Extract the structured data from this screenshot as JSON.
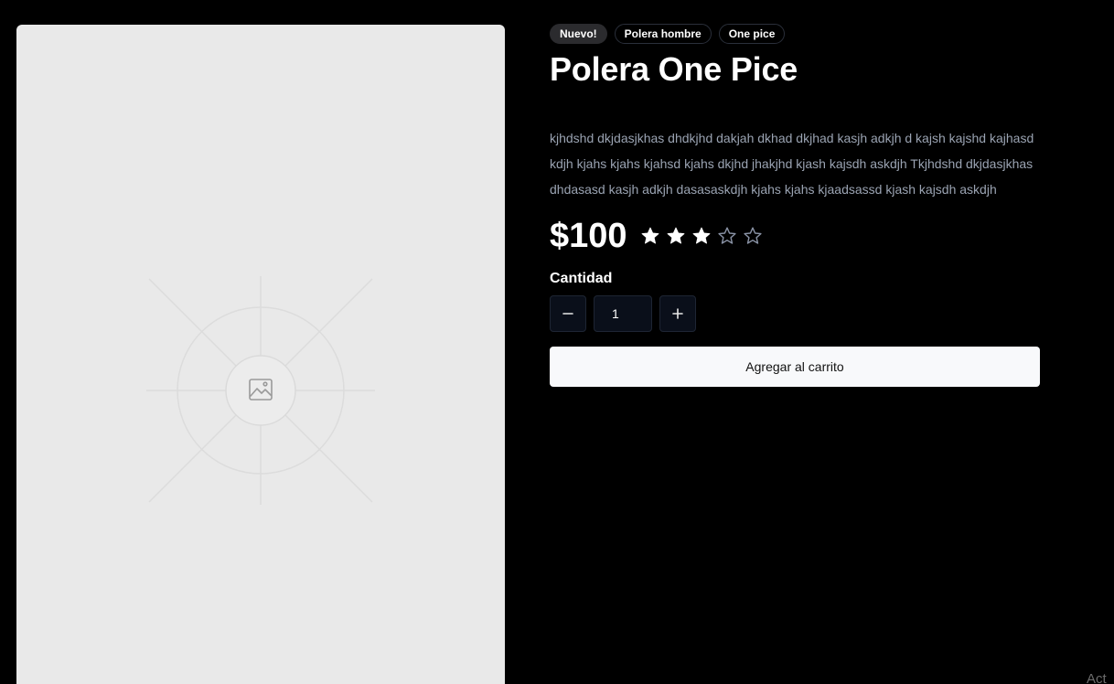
{
  "product": {
    "badges": [
      "Nuevo!",
      "Polera hombre",
      "One pice"
    ],
    "title": "Polera One Pice",
    "description": "kjhdshd dkjdasjkhas dhdkjhd dakjah dkhad dkjhad kasjh adkjh d kajsh kajshd kajhasd kdjh kjahs kjahs kjahsd kjahs dkjhd jhakjhd kjash kajsdh askdjh Tkjhdshd dkjdasjkhas dhdasasd kasjh adkjh dasasaskdjh kjahs kjahs kjaadsassd kjash kajsdh askdjh",
    "price": "$100",
    "rating": 3,
    "rating_max": 5,
    "image_icon": "image-placeholder-icon"
  },
  "quantity": {
    "label": "Cantidad",
    "value": "1",
    "decrement_icon": "minus-icon",
    "increment_icon": "plus-icon"
  },
  "cart": {
    "button_label": "Agregar al carrito"
  },
  "watermark": {
    "text": "Act"
  },
  "colors": {
    "background": "#000000",
    "image_panel": "#e9e9e9",
    "description_text": "#9aa3b2",
    "star_filled": "#ffffff",
    "star_empty_outline": "#8a93a6",
    "button_bg": "#f8f9fb"
  }
}
